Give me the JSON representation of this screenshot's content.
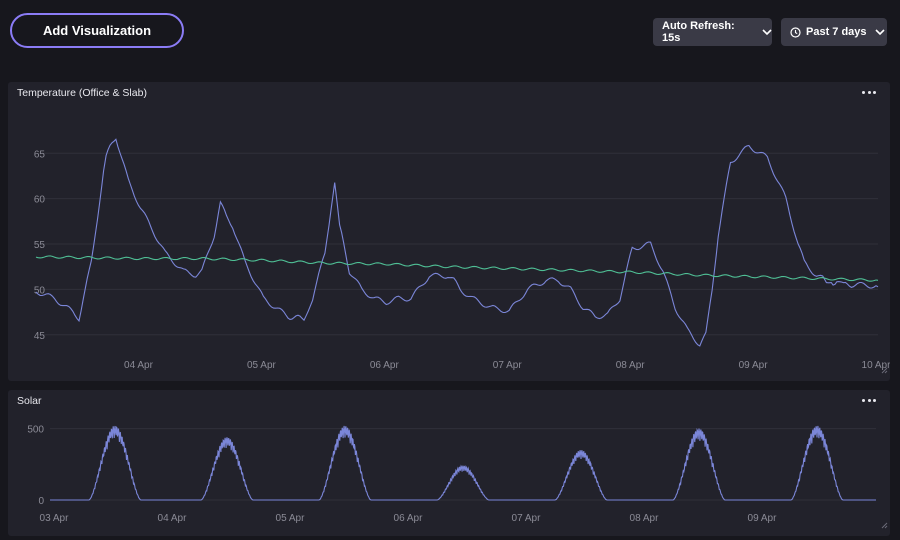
{
  "toolbar": {
    "add_visualization_label": "Add Visualization",
    "auto_refresh_label": "Auto Refresh: 15s",
    "time_range_label": "Past 7 days"
  },
  "colors": {
    "accent": "#8b7cf6",
    "series_line": "#7b86d8",
    "series_green": "#4fbf95",
    "panel_bg": "#22222b",
    "page_bg": "#17171d"
  },
  "icons": {
    "refresh_chevron": "chevron-down-icon",
    "range_icon": "clock-icon",
    "range_chevron": "chevron-down-icon",
    "panel_menu": "more-horizontal-icon",
    "panel_resize": "resize-handle-icon"
  },
  "panels": [
    {
      "title": "Temperature (Office & Slab)",
      "chart_data": {
        "type": "line",
        "x_tick_labels": [
          "04 Apr",
          "05 Apr",
          "06 Apr",
          "07 Apr",
          "08 Apr",
          "09 Apr",
          "10 Apr"
        ],
        "y_tick_labels": [
          "45",
          "50",
          "55",
          "60",
          "65"
        ],
        "xlim_days": [
          3.15,
          10.0
        ],
        "ylim": [
          42,
          69
        ],
        "grid": true,
        "series": [
          {
            "color": "#7b86d8",
            "x_days": [
              3.15,
              3.3,
              3.45,
              3.5,
              3.6,
              3.65,
              3.7,
              3.72,
              3.8,
              3.9,
              4.0,
              4.2,
              4.35,
              4.45,
              4.5,
              4.6,
              4.65,
              4.7,
              4.75,
              4.85,
              5.0,
              5.2,
              5.33,
              5.4,
              5.5,
              5.55,
              5.58,
              5.62,
              5.7,
              5.8,
              5.9,
              6.0,
              6.1,
              6.2,
              6.35,
              6.5,
              6.55,
              6.6,
              6.7,
              6.85,
              7.0,
              7.15,
              7.3,
              7.4,
              7.5,
              7.55,
              7.6,
              7.65,
              7.7,
              7.8,
              7.9,
              8.0,
              8.15,
              8.25,
              8.35,
              8.45,
              8.55,
              8.6,
              8.65,
              8.7,
              8.8,
              8.95,
              9.1,
              9.25,
              9.35,
              9.4,
              9.5,
              9.55,
              9.58,
              9.62,
              9.68,
              9.72,
              9.8,
              9.9,
              10.0
            ],
            "values": [
              49.8,
              49,
              47.5,
              46.8,
              53,
              58,
              63,
              64.8,
              66.8,
              62,
              59,
              54,
              52,
              51.6,
              52,
              56,
              59.5,
              58,
              57,
              53,
              49,
              47,
              46.8,
              49,
              54,
              59,
              61.5,
              57,
              52,
              50,
              49,
              48.6,
              49,
              49,
              51.5,
              51.5,
              51,
              50,
              49,
              48,
              47.6,
              50,
              51,
              51,
              50,
              49,
              48,
              47.5,
              47,
              47.2,
              49,
              54.5,
              55,
              52,
              48,
              45.5,
              43.9,
              45,
              50,
              56,
              64,
              65.8,
              64.5,
              60,
              55,
              53,
              51.5,
              51.2,
              51,
              50.8,
              50.6,
              50.5,
              50.5,
              50.5,
              50.3
            ]
          },
          {
            "color": "#4fbf95",
            "x_days": [
              3.15,
              4.0,
              4.5,
              5.0,
              5.5,
              6.0,
              6.5,
              7.0,
              7.5,
              8.0,
              8.5,
              9.0,
              9.5,
              10.0
            ],
            "values": [
              53.6,
              53.4,
              53.4,
              53.2,
              52.9,
              52.8,
              52.5,
              52.3,
              52.1,
              51.9,
              51.6,
              51.4,
              51.2,
              51.0
            ]
          }
        ]
      }
    },
    {
      "title": "Solar",
      "chart_data": {
        "type": "line",
        "x_tick_labels": [
          "03 Apr",
          "04 Apr",
          "05 Apr",
          "06 Apr",
          "07 Apr",
          "08 Apr",
          "09 Apr"
        ],
        "y_tick_labels": [
          "0",
          "500"
        ],
        "xlim_days": [
          3.0,
          10.0
        ],
        "ylim": [
          0,
          560
        ],
        "grid": true,
        "series": [
          {
            "color": "#7b86d8",
            "peak_days": [
              3.55,
              4.5,
              5.5,
              6.5,
              7.5,
              8.5,
              9.5
            ],
            "peak_values": [
              520,
              440,
              520,
              240,
              350,
              500,
              520
            ]
          }
        ]
      }
    }
  ]
}
